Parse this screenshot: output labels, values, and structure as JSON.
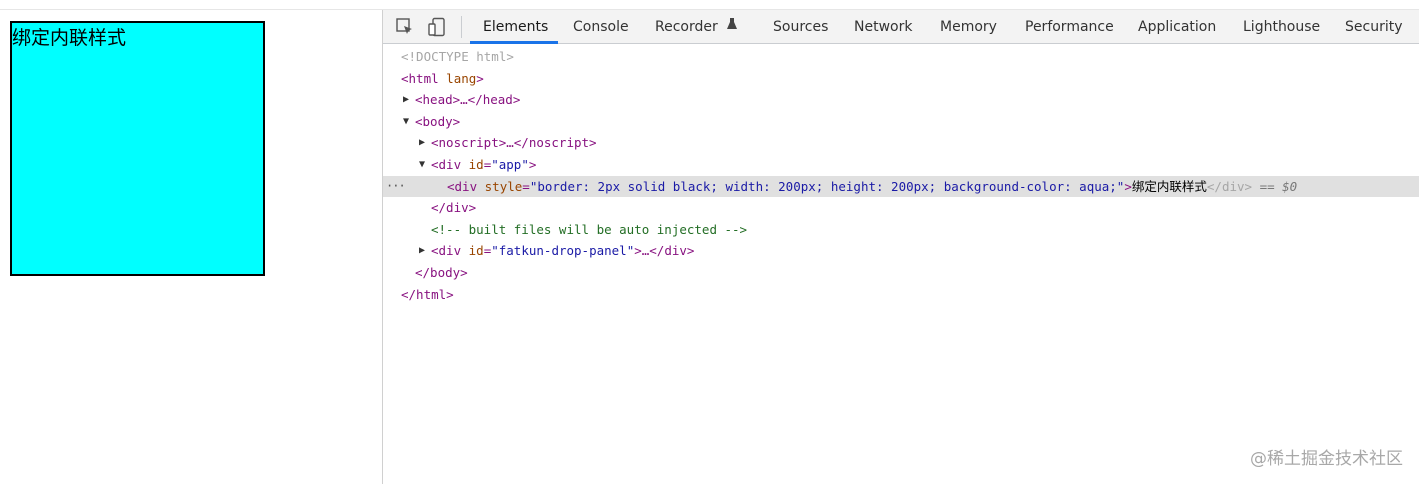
{
  "viewport": {
    "box_text": "绑定内联样式",
    "box_bg": "#00ffff"
  },
  "devtools": {
    "tabs": [
      "Elements",
      "Console",
      "Recorder",
      "Sources",
      "Network",
      "Memory",
      "Performance",
      "Application",
      "Lighthouse",
      "Security"
    ],
    "active_tab": "Elements",
    "icons": [
      "inspect-element-icon",
      "device-toolbar-icon",
      "flask-icon"
    ],
    "accent": "#1a73e8",
    "tree": {
      "doctype": "<!DOCTYPE html>",
      "html_open_tag": "<html",
      "html_attr": "lang",
      "html_open_close": ">",
      "head": "<head>…</head>",
      "body_open": "<body>",
      "noscript": "<noscript>…</noscript>",
      "div_app_open": "<div",
      "id_attr": "id",
      "app_id_value": "\"app\"",
      "gt": ">",
      "eq": "=",
      "div_style_open": "<div",
      "style_attr": "style",
      "style_value": "\"border: 2px solid black; width: 200px; height: 200px; background-color: aqua;\"",
      "div_text": "绑定内联样式",
      "div_close": "</div>",
      "selected_marker": "== $0",
      "ellipsis": "···",
      "div_app_close": "</div>",
      "comment": "<!-- built files will be auto injected -->",
      "fatkun_id_value": "\"fatkun-drop-panel\"",
      "fatkun_tail": ">…</div>",
      "body_close": "</body>",
      "html_close": "</html>"
    }
  },
  "watermark": "@稀土掘金技术社区"
}
